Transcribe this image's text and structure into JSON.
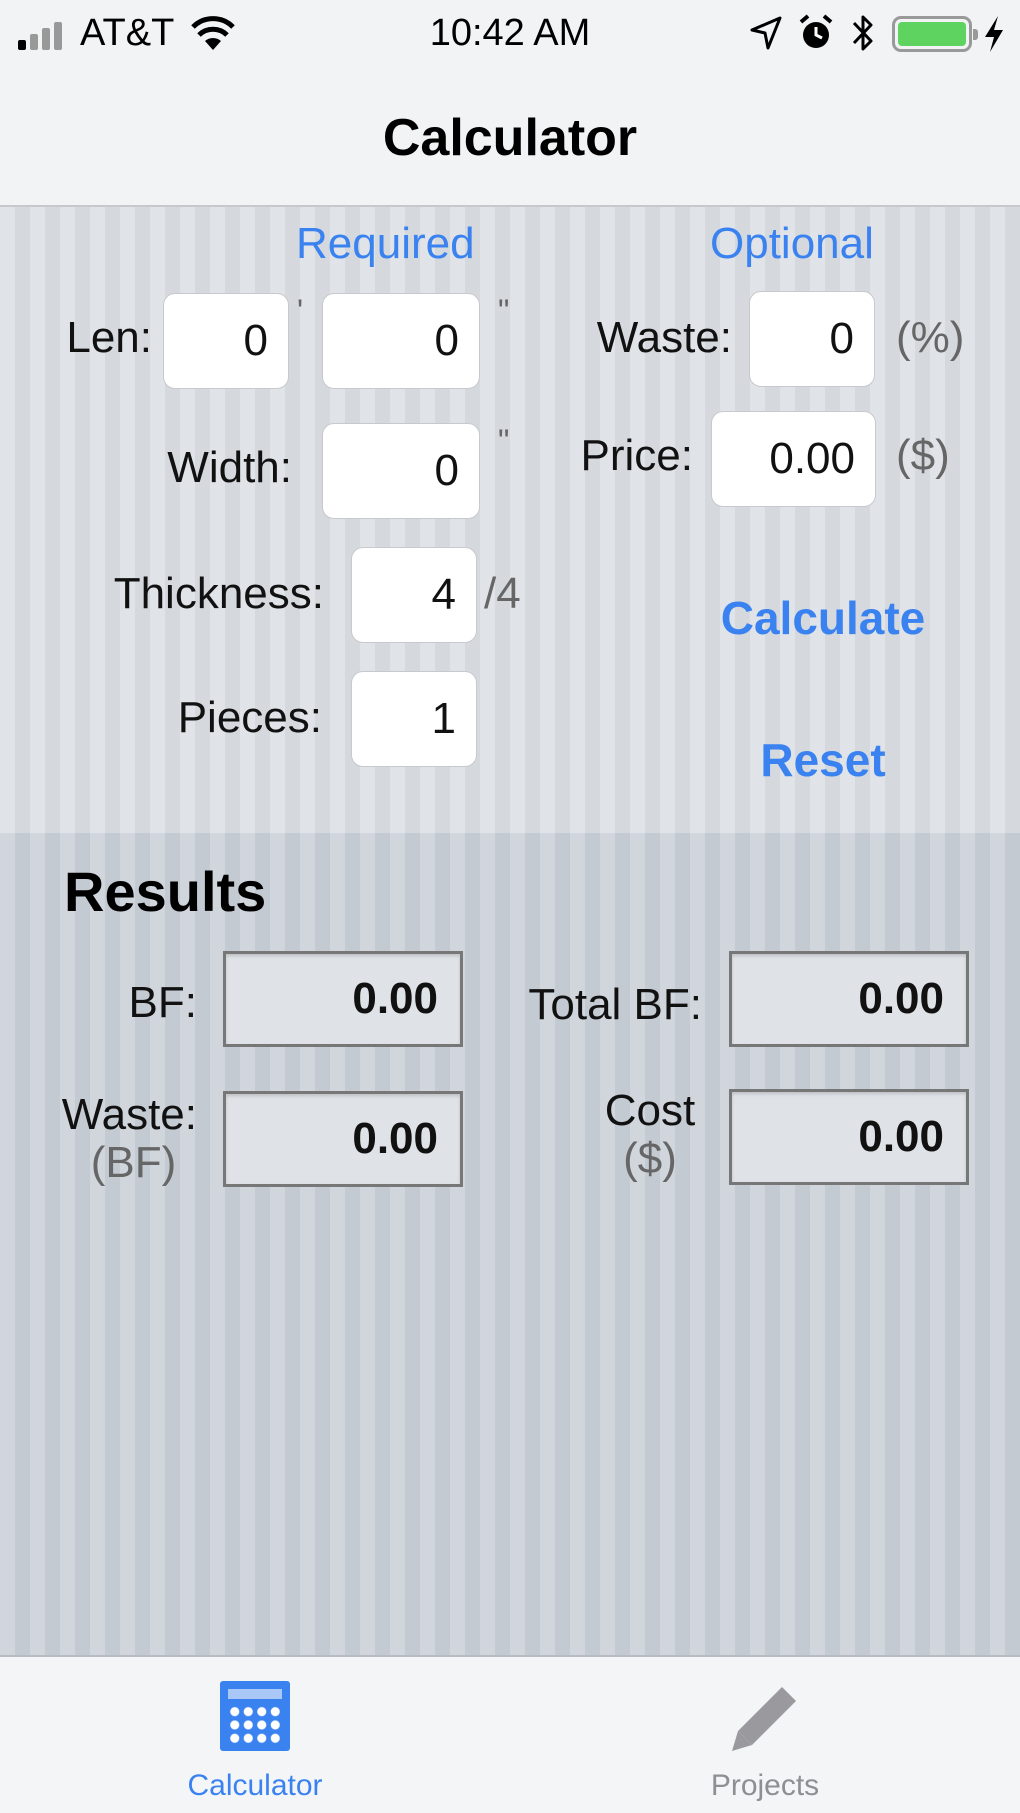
{
  "status_bar": {
    "carrier": "AT&T",
    "time": "10:42 AM",
    "icons": [
      "signal-icon",
      "wifi-icon",
      "location-arrow-icon",
      "alarm-icon",
      "bluetooth-icon",
      "battery-icon",
      "charging-bolt-icon"
    ],
    "battery_color": "#5fd35f"
  },
  "nav": {
    "title": "Calculator"
  },
  "inputs": {
    "required_heading": "Required",
    "optional_heading": "Optional",
    "length": {
      "label": "Len:",
      "feet": "0",
      "feet_unit": "'",
      "inches": "0",
      "inches_unit": "\""
    },
    "width": {
      "label": "Width:",
      "value": "0",
      "unit": "\""
    },
    "thickness": {
      "label": "Thickness:",
      "value": "4",
      "unit": "/4"
    },
    "pieces": {
      "label": "Pieces:",
      "value": "1"
    },
    "waste": {
      "label": "Waste:",
      "value": "0",
      "unit": "(%)"
    },
    "price": {
      "label": "Price:",
      "value": "0.00",
      "unit": "($)"
    },
    "calculate_label": "Calculate",
    "reset_label": "Reset"
  },
  "results": {
    "heading": "Results",
    "bf": {
      "label": "BF:",
      "value": "0.00"
    },
    "total_bf": {
      "label": "Total BF:",
      "value": "0.00"
    },
    "waste": {
      "label": "Waste:",
      "sub": "(BF)",
      "value": "0.00"
    },
    "cost": {
      "label": "Cost",
      "sub": "($)",
      "value": "0.00"
    }
  },
  "tab_bar": {
    "tabs": [
      {
        "label": "Calculator",
        "icon": "calculator-icon",
        "active": true
      },
      {
        "label": "Projects",
        "icon": "pencil-icon",
        "active": false
      }
    ],
    "active_color": "#3a82f0",
    "inactive_color": "#8e8e93"
  }
}
